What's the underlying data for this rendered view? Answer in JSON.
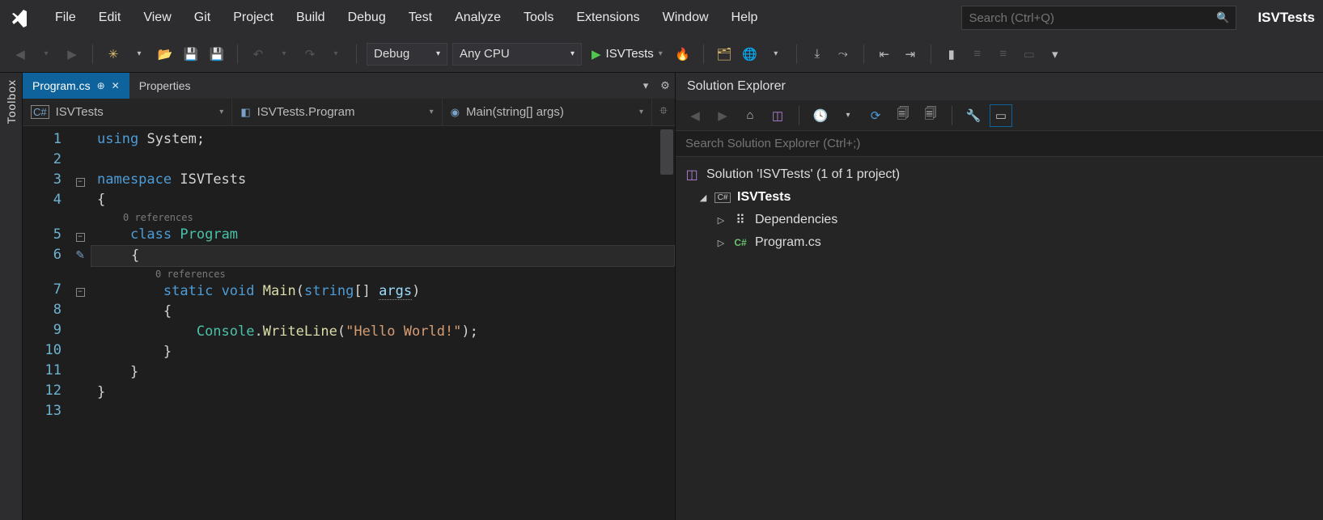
{
  "menus": [
    "File",
    "Edit",
    "View",
    "Git",
    "Project",
    "Build",
    "Debug",
    "Test",
    "Analyze",
    "Tools",
    "Extensions",
    "Window",
    "Help"
  ],
  "search": {
    "placeholder": "Search (Ctrl+Q)"
  },
  "solution_name": "ISVTests",
  "toolbar": {
    "config": "Debug",
    "platform": "Any CPU",
    "start_target": "ISVTests"
  },
  "tabs": {
    "active": "Program.cs",
    "other": "Properties"
  },
  "navbar": {
    "project": "ISVTests",
    "class": "ISVTests.Program",
    "member": "Main(string[] args)"
  },
  "code": {
    "line_numbers": [
      "1",
      "2",
      "3",
      "4",
      "5",
      "6",
      "7",
      "8",
      "9",
      "10",
      "11",
      "12",
      "13"
    ],
    "codelens": "0 references",
    "lines_html": [
      "<span class=\"kw\">using</span> <span class=\"punc\">System;</span>",
      "",
      "<span class=\"kw\">namespace</span> <span class=\"punc\">ISVTests</span>",
      "<span class=\"punc\">{</span>",
      "    <span class=\"kw\">class</span> <span class=\"type\">Program</span>",
      "    <span class=\"punc\">{</span>",
      "        <span class=\"kw\">static</span> <span class=\"kw\">void</span> <span class=\"ident\">Main</span><span class=\"punc\">(</span><span class=\"kw\">string</span><span class=\"punc\">[]</span> <span class=\"param dotted\">args</span><span class=\"punc\">)</span>",
      "        <span class=\"punc\">{</span>",
      "            <span class=\"type\">Console</span><span class=\"punc\">.</span><span class=\"ident\">WriteLine</span><span class=\"punc\">(</span><span class=\"str\">\"Hello World!\"</span><span class=\"punc\">);</span>",
      "        <span class=\"punc\">}</span>",
      "    <span class=\"punc\">}</span>",
      "<span class=\"punc\">}</span>",
      ""
    ]
  },
  "solution_explorer": {
    "title": "Solution Explorer",
    "search_placeholder": "Search Solution Explorer (Ctrl+;)",
    "root": "Solution 'ISVTests' (1 of 1 project)",
    "project": "ISVTests",
    "nodes": [
      "Dependencies",
      "Program.cs"
    ]
  },
  "toolbox_label": "Toolbox"
}
